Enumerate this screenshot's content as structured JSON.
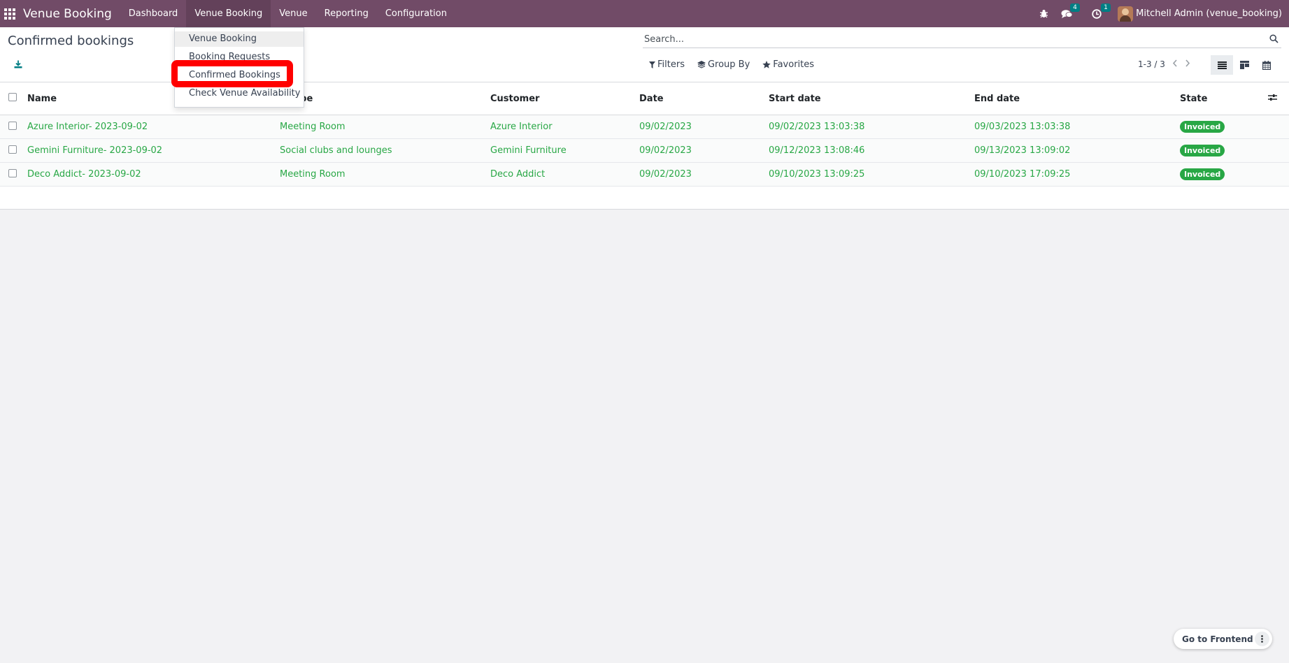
{
  "navbar": {
    "app_name": "Venue Booking",
    "menus": [
      "Dashboard",
      "Venue Booking",
      "Venue",
      "Reporting",
      "Configuration"
    ],
    "messages_count": "4",
    "activities_count": "1",
    "user_name": "Mitchell Admin (venue_booking)"
  },
  "dropdown": {
    "items": [
      "Venue Booking",
      "Booking Requests",
      "Confirmed Bookings",
      "Check Venue Availability"
    ]
  },
  "page": {
    "title": "Confirmed bookings"
  },
  "search": {
    "placeholder": "Search..."
  },
  "filters": {
    "filters_label": "Filters",
    "group_by_label": "Group By",
    "favorites_label": "Favorites"
  },
  "pager": {
    "text": "1-3 / 3"
  },
  "table": {
    "headers": [
      "Name",
      "e Type",
      "Customer",
      "Date",
      "Start date",
      "End date",
      "State"
    ],
    "rows": [
      [
        "Azure Interior- 2023-09-02",
        "Meeting Room",
        "Azure Interior",
        "09/02/2023",
        "09/02/2023 13:03:38",
        "09/03/2023 13:03:38",
        "Invoiced"
      ],
      [
        "Gemini Furniture- 2023-09-02",
        "Social clubs and lounges",
        "Gemini Furniture",
        "09/02/2023",
        "09/12/2023 13:08:46",
        "09/13/2023 13:09:02",
        "Invoiced"
      ],
      [
        "Deco Addict- 2023-09-02",
        "Meeting Room",
        "Deco Addict",
        "09/02/2023",
        "09/10/2023 13:09:25",
        "09/10/2023 17:09:25",
        "Invoiced"
      ]
    ]
  },
  "frontend": {
    "label": "Go to Frontend"
  },
  "colors": {
    "navbar": "#714B67",
    "accent_teal": "#017e84",
    "row_text": "#28a745",
    "state_badge": "#28a745",
    "highlight": "#ff0000"
  }
}
